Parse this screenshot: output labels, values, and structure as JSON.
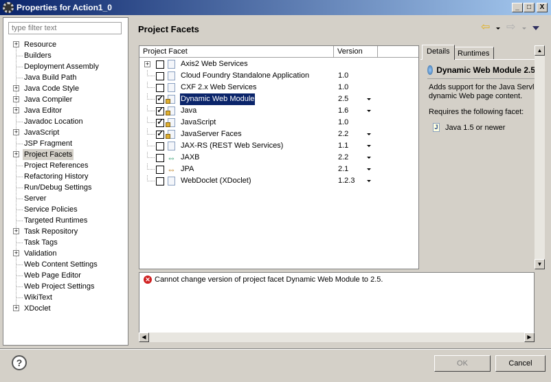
{
  "window": {
    "title": "Properties for Action1_0",
    "min": "_",
    "max": "□",
    "close": "X"
  },
  "filter": {
    "placeholder": "type filter text"
  },
  "nav": [
    {
      "label": "Resource",
      "expandable": true
    },
    {
      "label": "Builders",
      "expandable": false
    },
    {
      "label": "Deployment Assembly",
      "expandable": false
    },
    {
      "label": "Java Build Path",
      "expandable": false
    },
    {
      "label": "Java Code Style",
      "expandable": true
    },
    {
      "label": "Java Compiler",
      "expandable": true
    },
    {
      "label": "Java Editor",
      "expandable": true
    },
    {
      "label": "Javadoc Location",
      "expandable": false
    },
    {
      "label": "JavaScript",
      "expandable": true
    },
    {
      "label": "JSP Fragment",
      "expandable": false
    },
    {
      "label": "Project Facets",
      "expandable": true,
      "selected": true
    },
    {
      "label": "Project References",
      "expandable": false
    },
    {
      "label": "Refactoring History",
      "expandable": false
    },
    {
      "label": "Run/Debug Settings",
      "expandable": false
    },
    {
      "label": "Server",
      "expandable": false
    },
    {
      "label": "Service Policies",
      "expandable": false
    },
    {
      "label": "Targeted Runtimes",
      "expandable": false
    },
    {
      "label": "Task Repository",
      "expandable": true
    },
    {
      "label": "Task Tags",
      "expandable": false
    },
    {
      "label": "Validation",
      "expandable": true
    },
    {
      "label": "Web Content Settings",
      "expandable": false
    },
    {
      "label": "Web Page Editor",
      "expandable": false
    },
    {
      "label": "Web Project Settings",
      "expandable": false
    },
    {
      "label": "WikiText",
      "expandable": false
    },
    {
      "label": "XDoclet",
      "expandable": true
    }
  ],
  "page": {
    "title": "Project Facets"
  },
  "table": {
    "headers": [
      "Project Facet",
      "Version"
    ],
    "rows": [
      {
        "name": "Axis2 Web Services",
        "version": "",
        "checked": false,
        "expandable": true,
        "dropdown": false
      },
      {
        "name": "Cloud Foundry Standalone Application",
        "version": "1.0",
        "checked": false,
        "dropdown": false
      },
      {
        "name": "CXF 2.x Web Services",
        "version": "1.0",
        "checked": false,
        "dropdown": false
      },
      {
        "name": "Dynamic Web Module",
        "version": "2.5",
        "checked": true,
        "dropdown": true,
        "selected": true
      },
      {
        "name": "Java",
        "version": "1.6",
        "checked": true,
        "dropdown": true
      },
      {
        "name": "JavaScript",
        "version": "1.0",
        "checked": true,
        "dropdown": false
      },
      {
        "name": "JavaServer Faces",
        "version": "2.2",
        "checked": true,
        "dropdown": true
      },
      {
        "name": "JAX-RS (REST Web Services)",
        "version": "1.1",
        "checked": false,
        "dropdown": true
      },
      {
        "name": "JAXB",
        "version": "2.2",
        "checked": false,
        "dropdown": true
      },
      {
        "name": "JPA",
        "version": "2.1",
        "checked": false,
        "dropdown": true
      },
      {
        "name": "WebDoclet (XDoclet)",
        "version": "1.2.3",
        "checked": false,
        "dropdown": true
      }
    ]
  },
  "details": {
    "tabs": [
      "Details",
      "Runtimes"
    ],
    "title": "Dynamic Web Module 2.5",
    "desc1": "Adds support for the Java Servlet API, for generation of",
    "desc2": "dynamic Web page content.",
    "requires": "Requires the following facet:",
    "req_item": "Java 1.5 or newer"
  },
  "message": "Cannot change version of project facet Dynamic Web Module to 2.5.",
  "buttons": {
    "help": "?",
    "ok": "OK",
    "cancel": "Cancel"
  }
}
